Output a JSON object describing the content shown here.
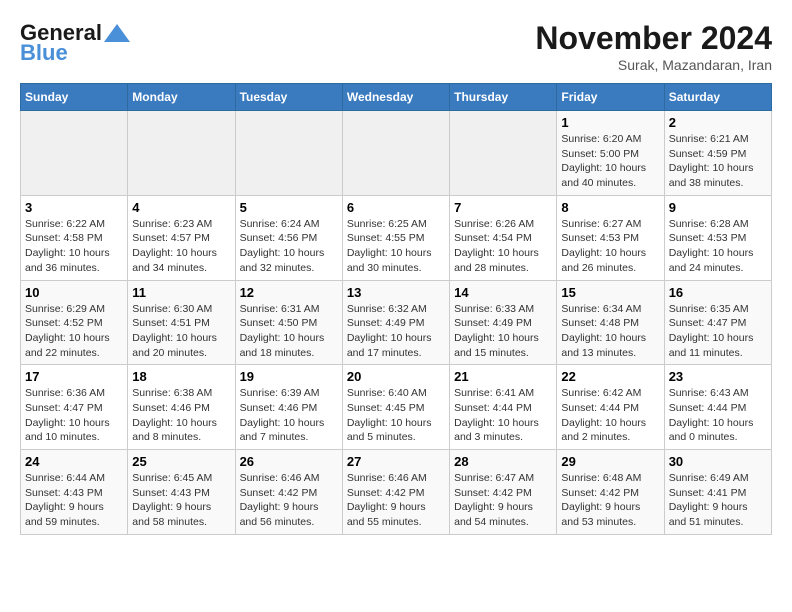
{
  "header": {
    "logo_general": "General",
    "logo_blue": "Blue",
    "month_title": "November 2024",
    "subtitle": "Surak, Mazandaran, Iran"
  },
  "days_of_week": [
    "Sunday",
    "Monday",
    "Tuesday",
    "Wednesday",
    "Thursday",
    "Friday",
    "Saturday"
  ],
  "weeks": [
    [
      {
        "day": "",
        "info": ""
      },
      {
        "day": "",
        "info": ""
      },
      {
        "day": "",
        "info": ""
      },
      {
        "day": "",
        "info": ""
      },
      {
        "day": "",
        "info": ""
      },
      {
        "day": "1",
        "info": "Sunrise: 6:20 AM\nSunset: 5:00 PM\nDaylight: 10 hours and 40 minutes."
      },
      {
        "day": "2",
        "info": "Sunrise: 6:21 AM\nSunset: 4:59 PM\nDaylight: 10 hours and 38 minutes."
      }
    ],
    [
      {
        "day": "3",
        "info": "Sunrise: 6:22 AM\nSunset: 4:58 PM\nDaylight: 10 hours and 36 minutes."
      },
      {
        "day": "4",
        "info": "Sunrise: 6:23 AM\nSunset: 4:57 PM\nDaylight: 10 hours and 34 minutes."
      },
      {
        "day": "5",
        "info": "Sunrise: 6:24 AM\nSunset: 4:56 PM\nDaylight: 10 hours and 32 minutes."
      },
      {
        "day": "6",
        "info": "Sunrise: 6:25 AM\nSunset: 4:55 PM\nDaylight: 10 hours and 30 minutes."
      },
      {
        "day": "7",
        "info": "Sunrise: 6:26 AM\nSunset: 4:54 PM\nDaylight: 10 hours and 28 minutes."
      },
      {
        "day": "8",
        "info": "Sunrise: 6:27 AM\nSunset: 4:53 PM\nDaylight: 10 hours and 26 minutes."
      },
      {
        "day": "9",
        "info": "Sunrise: 6:28 AM\nSunset: 4:53 PM\nDaylight: 10 hours and 24 minutes."
      }
    ],
    [
      {
        "day": "10",
        "info": "Sunrise: 6:29 AM\nSunset: 4:52 PM\nDaylight: 10 hours and 22 minutes."
      },
      {
        "day": "11",
        "info": "Sunrise: 6:30 AM\nSunset: 4:51 PM\nDaylight: 10 hours and 20 minutes."
      },
      {
        "day": "12",
        "info": "Sunrise: 6:31 AM\nSunset: 4:50 PM\nDaylight: 10 hours and 18 minutes."
      },
      {
        "day": "13",
        "info": "Sunrise: 6:32 AM\nSunset: 4:49 PM\nDaylight: 10 hours and 17 minutes."
      },
      {
        "day": "14",
        "info": "Sunrise: 6:33 AM\nSunset: 4:49 PM\nDaylight: 10 hours and 15 minutes."
      },
      {
        "day": "15",
        "info": "Sunrise: 6:34 AM\nSunset: 4:48 PM\nDaylight: 10 hours and 13 minutes."
      },
      {
        "day": "16",
        "info": "Sunrise: 6:35 AM\nSunset: 4:47 PM\nDaylight: 10 hours and 11 minutes."
      }
    ],
    [
      {
        "day": "17",
        "info": "Sunrise: 6:36 AM\nSunset: 4:47 PM\nDaylight: 10 hours and 10 minutes."
      },
      {
        "day": "18",
        "info": "Sunrise: 6:38 AM\nSunset: 4:46 PM\nDaylight: 10 hours and 8 minutes."
      },
      {
        "day": "19",
        "info": "Sunrise: 6:39 AM\nSunset: 4:46 PM\nDaylight: 10 hours and 7 minutes."
      },
      {
        "day": "20",
        "info": "Sunrise: 6:40 AM\nSunset: 4:45 PM\nDaylight: 10 hours and 5 minutes."
      },
      {
        "day": "21",
        "info": "Sunrise: 6:41 AM\nSunset: 4:44 PM\nDaylight: 10 hours and 3 minutes."
      },
      {
        "day": "22",
        "info": "Sunrise: 6:42 AM\nSunset: 4:44 PM\nDaylight: 10 hours and 2 minutes."
      },
      {
        "day": "23",
        "info": "Sunrise: 6:43 AM\nSunset: 4:44 PM\nDaylight: 10 hours and 0 minutes."
      }
    ],
    [
      {
        "day": "24",
        "info": "Sunrise: 6:44 AM\nSunset: 4:43 PM\nDaylight: 9 hours and 59 minutes."
      },
      {
        "day": "25",
        "info": "Sunrise: 6:45 AM\nSunset: 4:43 PM\nDaylight: 9 hours and 58 minutes."
      },
      {
        "day": "26",
        "info": "Sunrise: 6:46 AM\nSunset: 4:42 PM\nDaylight: 9 hours and 56 minutes."
      },
      {
        "day": "27",
        "info": "Sunrise: 6:46 AM\nSunset: 4:42 PM\nDaylight: 9 hours and 55 minutes."
      },
      {
        "day": "28",
        "info": "Sunrise: 6:47 AM\nSunset: 4:42 PM\nDaylight: 9 hours and 54 minutes."
      },
      {
        "day": "29",
        "info": "Sunrise: 6:48 AM\nSunset: 4:42 PM\nDaylight: 9 hours and 53 minutes."
      },
      {
        "day": "30",
        "info": "Sunrise: 6:49 AM\nSunset: 4:41 PM\nDaylight: 9 hours and 51 minutes."
      }
    ]
  ]
}
